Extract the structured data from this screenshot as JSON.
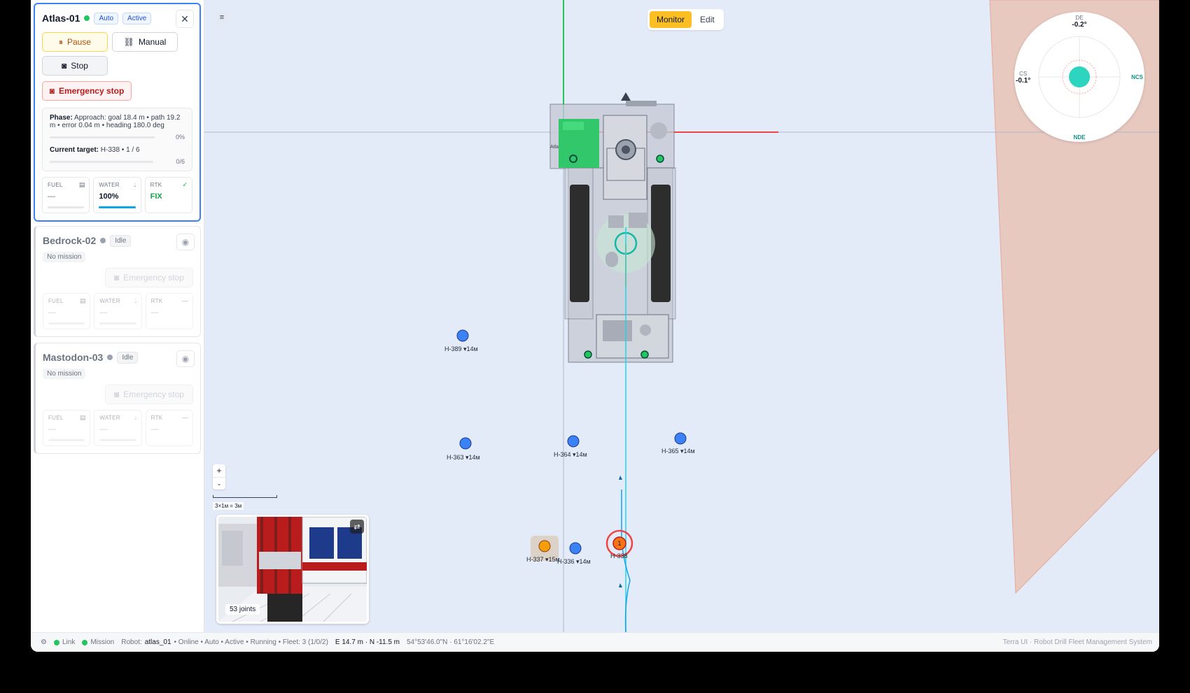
{
  "robots": [
    {
      "name": "Atlas-01",
      "badges": [
        "Auto",
        "Active"
      ],
      "buttons": {
        "pause": "Pause",
        "manual": "Manual",
        "stop": "Stop",
        "estop": "Emergency stop"
      },
      "phase_label": "Phase:",
      "phase_text": "Approach: goal 18.4 m • path 19.2 m • error 0.04 m • heading 180.0 deg",
      "phase_progress": "0%",
      "target_label": "Current target:",
      "target_text": "H-338 • 1 / 6",
      "target_progress": "0/6",
      "metrics": {
        "fuel_label": "FUEL",
        "fuel_value": "—",
        "water_label": "WATER",
        "water_value": "100%",
        "water_fraction": 1.0,
        "rtk_label": "RTK",
        "rtk_value": "FIX"
      }
    },
    {
      "name": "Bedrock-02",
      "badge": "Idle",
      "mission": "No mission",
      "estop": "Emergency stop",
      "metrics": {
        "fuel_label": "FUEL",
        "fuel_value": "—",
        "water_label": "WATER",
        "water_value": "—",
        "rtk_label": "RTK",
        "rtk_value": "—",
        "rtk_icon": "—"
      }
    },
    {
      "name": "Mastodon-03",
      "badge": "Idle",
      "mission": "No mission",
      "estop": "Emergency stop",
      "metrics": {
        "fuel_label": "FUEL",
        "fuel_value": "—",
        "water_label": "WATER",
        "water_value": "—",
        "rtk_label": "RTK",
        "rtk_value": "—",
        "rtk_icon": "—"
      }
    }
  ],
  "map": {
    "mode": {
      "monitor": "Monitor",
      "edit": "Edit"
    },
    "zoom_in": "+",
    "zoom_out": "-",
    "scale": "3×1м = 3м",
    "camera_joints": "53 joints",
    "robot_label": "Atla",
    "target_number": "1",
    "holes": {
      "h389": "H-389",
      "h389_depth": "▾14м",
      "h363": "H-363",
      "h363_depth": "▾14м",
      "h364": "H-364",
      "h364_depth": "▾14м",
      "h365": "H-365",
      "h365_depth": "▾14м",
      "h336": "H-336",
      "h336_depth": "▾14м",
      "h337": "H-337",
      "h337_depth": "▾15м",
      "h338": "H-338"
    },
    "compass": {
      "top_label": "DE",
      "top_value": "-0.2°",
      "left_label": "CS",
      "left_value": "-0.1°",
      "right_label": "NCS",
      "bottom_label": "NDE"
    },
    "colors": {
      "accent": "#fbbf24",
      "hole": "#3b82f6",
      "path": "#22d3ee",
      "target": "#ef4444",
      "zone": "#e8c9c0"
    }
  },
  "status": {
    "link": "Link",
    "mission": "Mission",
    "robot_label": "Robot:",
    "robot_id": "atlas_01",
    "robot_state": "• Online • Auto • Active • Running • Fleet: 3 (1/0/2)",
    "coords": "E 14.7 m · N -11.5 m",
    "geo": "54°53'46.0\"N · 61°16'02.2\"E",
    "brand": "Terra UI · Robot Drill Fleet Management System"
  }
}
